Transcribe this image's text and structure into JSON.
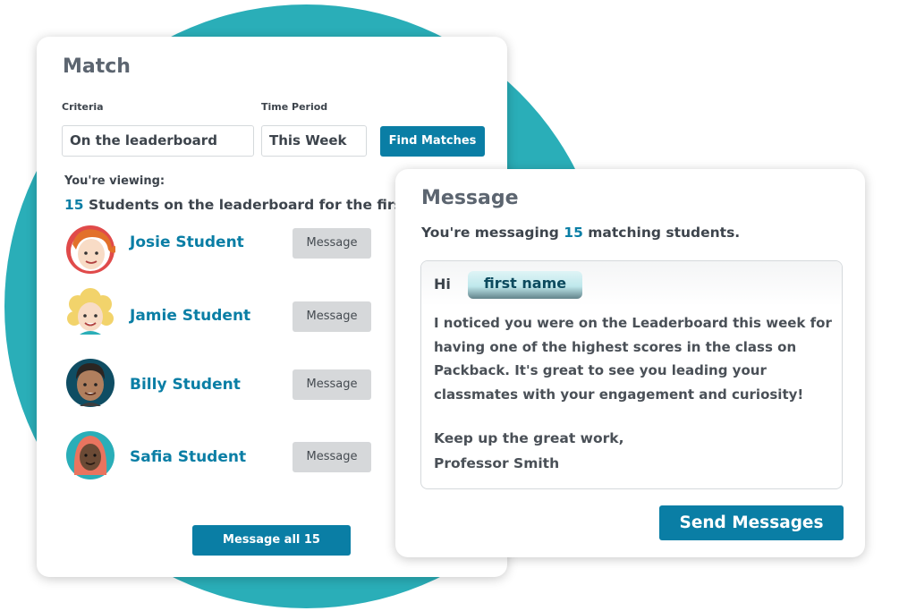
{
  "match": {
    "title": "Match",
    "criteria_label": "Criteria",
    "criteria_value": "On the leaderboard",
    "time_period_label": "Time Period",
    "time_period_value": "This Week",
    "find_button": "Find Matches",
    "viewing_label": "You're viewing:",
    "viewing_count": "15",
    "viewing_text": " Students on the leaderboard for the first time",
    "students": [
      {
        "name": "Josie Student",
        "button": "Message",
        "avatar": "girl-red-hair-avatar"
      },
      {
        "name": "Jamie Student",
        "button": "Message",
        "avatar": "girl-blonde-curly-avatar"
      },
      {
        "name": "Billy Student",
        "button": "Message",
        "avatar": "boy-dark-hair-avatar"
      },
      {
        "name": "Safia Student",
        "button": "Message",
        "avatar": "girl-hijab-avatar"
      }
    ],
    "message_all_button": "Message all 15"
  },
  "message": {
    "title": "Message",
    "sub_prefix": "You're messaging ",
    "sub_count": "15",
    "sub_suffix": " matching students.",
    "greeting": "Hi",
    "name_token": "first name",
    "body": "I noticed you were on the Leaderboard this week for having one of the highest scores in the class on Packback. It's great to see you leading your classmates with your engagement and curiosity!",
    "signoff_line1": "Keep up the great work,",
    "signoff_line2": "Professor Smith",
    "send_button": "Send Messages"
  },
  "colors": {
    "accent": "#0a7ea5",
    "circle": "#2aaeb8",
    "button_gray": "#d6d8da"
  }
}
